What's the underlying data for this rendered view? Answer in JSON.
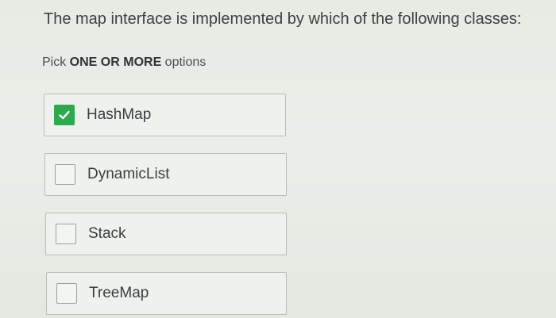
{
  "question": {
    "text": "The map interface is implemented by which of the following classes:"
  },
  "instruction": {
    "prefix": "Pick ",
    "emphasis": "ONE OR MORE",
    "suffix": " options"
  },
  "options": [
    {
      "label": "HashMap",
      "checked": true,
      "icon": "checkmark-icon"
    },
    {
      "label": "DynamicList",
      "checked": false
    },
    {
      "label": "Stack",
      "checked": false
    },
    {
      "label": "TreeMap",
      "checked": false
    }
  ],
  "colors": {
    "accent_check": "#2fa84f",
    "background": "#e9ece6"
  }
}
